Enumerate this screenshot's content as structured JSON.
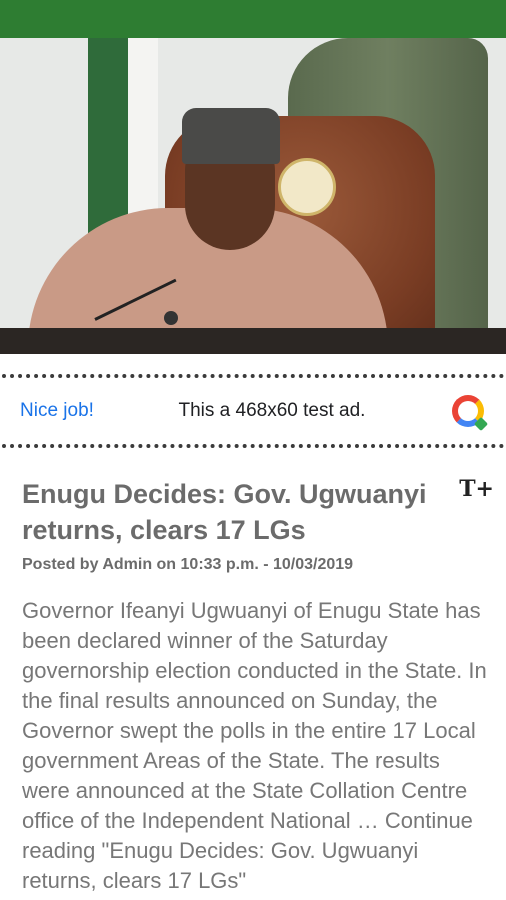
{
  "app": {
    "accent_color": "#2e7d32"
  },
  "hero": {
    "image_alt": "photo-hero"
  },
  "ad": {
    "left_label": "Nice job!",
    "text": "This a 468x60 test ad.",
    "logo_icon": "google-ads-logo"
  },
  "article": {
    "title": "Enugu Decides: Gov. Ugwuanyi returns, clears 17 LGs",
    "text_size_icon": "text-size-icon",
    "text_size_glyph": "T+",
    "meta": "Posted by Admin on 10:33 p.m. - 10/03/2019",
    "body": "Governor Ifeanyi Ugwuanyi of Enugu State has been declared winner of the Saturday governorship election conducted in the State. In the final results announced on Sunday, the Governor swept the polls in the entire 17 Local government Areas of the State. The results were announced at the State Collation Centre office of the Independent National … Continue reading \"Enugu Decides: Gov. Ugwuanyi returns, clears 17 LGs\""
  }
}
